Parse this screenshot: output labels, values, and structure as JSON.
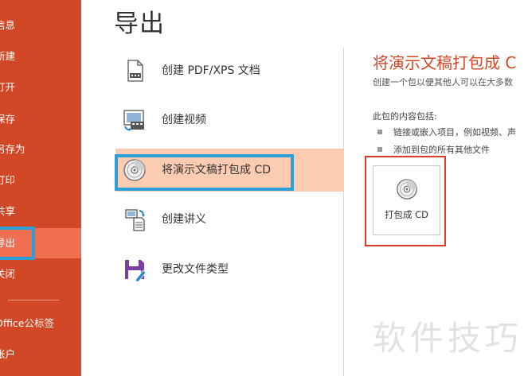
{
  "sidebar": {
    "items": [
      {
        "label": "信息"
      },
      {
        "label": "新建"
      },
      {
        "label": "打开"
      },
      {
        "label": "保存"
      },
      {
        "label": "另存为"
      },
      {
        "label": "打印"
      },
      {
        "label": "共享"
      },
      {
        "label": "导出",
        "selected": true
      },
      {
        "label": "关闭"
      },
      {
        "label": "Office公标签"
      },
      {
        "label": "帐户"
      }
    ]
  },
  "page": {
    "title": "导出"
  },
  "options": [
    {
      "label": "创建 PDF/XPS 文档",
      "icon": "pdf-document-icon"
    },
    {
      "label": "创建视频",
      "icon": "video-icon"
    },
    {
      "label": "将演示文稿打包成 CD",
      "icon": "cd-icon",
      "selected": true
    },
    {
      "label": "创建讲义",
      "icon": "handout-icon"
    },
    {
      "label": "更改文件类型",
      "icon": "save-filetype-icon"
    }
  ],
  "panel": {
    "heading": "将演示文稿打包成 C",
    "description": "创建一个包以便其他人可以在大多数",
    "contains_label": "此包的内容包括:",
    "bullets": [
      "链接或嵌入项目，例如视频、声",
      "添加到包的所有其他文件"
    ],
    "button_label": "打包成 CD"
  },
  "watermark": "软件技巧",
  "colors": {
    "sidebar": "#d24726",
    "sidebar_selected": "#ef6f50",
    "option_selected": "#fbcbb2",
    "highlight_blue": "#2a9fd8",
    "highlight_red": "#d73c2c"
  }
}
